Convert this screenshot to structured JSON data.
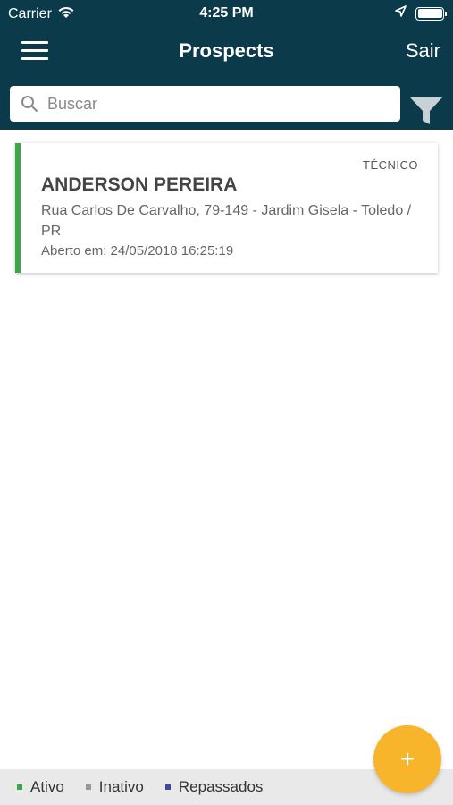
{
  "status_bar": {
    "carrier": "Carrier",
    "time": "4:25 PM"
  },
  "nav": {
    "title": "Prospects",
    "logout_label": "Sair"
  },
  "search": {
    "placeholder": "Buscar",
    "value": ""
  },
  "prospects": [
    {
      "tag": "TÉCNICO",
      "name": "ANDERSON PEREIRA",
      "address": "Rua Carlos De Carvalho, 79-149 - Jardim Gisela - Toledo / PR",
      "opened": "Aberto em: 24/05/2018 16:25:19",
      "status_color": "#3aa84a"
    }
  ],
  "legend": {
    "items": [
      {
        "label": "Ativo",
        "color": "#3aa84a"
      },
      {
        "label": "Inativo",
        "color": "#999999"
      },
      {
        "label": "Repassados",
        "color": "#3a4aa8"
      }
    ]
  },
  "fab": {
    "label": "+",
    "color": "#f7b52c"
  },
  "colors": {
    "header": "#0b3a4a",
    "legend_background": "#e9e9e9"
  }
}
